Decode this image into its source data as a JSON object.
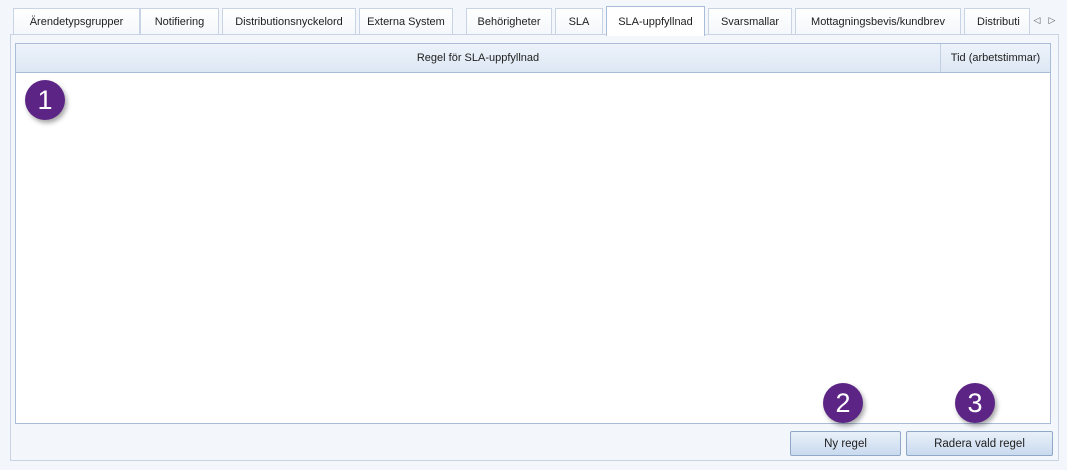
{
  "tabs": [
    {
      "label": "Ärendetypsgrupper"
    },
    {
      "label": "Notifiering"
    },
    {
      "label": "Distributionsnyckelord"
    },
    {
      "label": "Externa System"
    },
    {
      "label": "Behörigheter"
    },
    {
      "label": "SLA"
    },
    {
      "label": "SLA-uppfyllnad",
      "active": true
    },
    {
      "label": "Svarsmallar"
    },
    {
      "label": "Mottagningsbevis/kundbrev"
    },
    {
      "label": "Distributi"
    }
  ],
  "tab_scroll": {
    "left_glyph": "◁",
    "right_glyph": "▷"
  },
  "grid": {
    "columns": [
      {
        "label": "Regel för SLA-uppfyllnad"
      },
      {
        "label": "Tid (arbetstimmar)"
      }
    ],
    "rows": []
  },
  "buttons": {
    "new_rule": "Ny regel",
    "delete_rule": "Radera vald regel"
  },
  "callouts": [
    "1",
    "2",
    "3"
  ],
  "colors": {
    "callout": "#5c2585",
    "accent_border": "#a9bdd8"
  }
}
